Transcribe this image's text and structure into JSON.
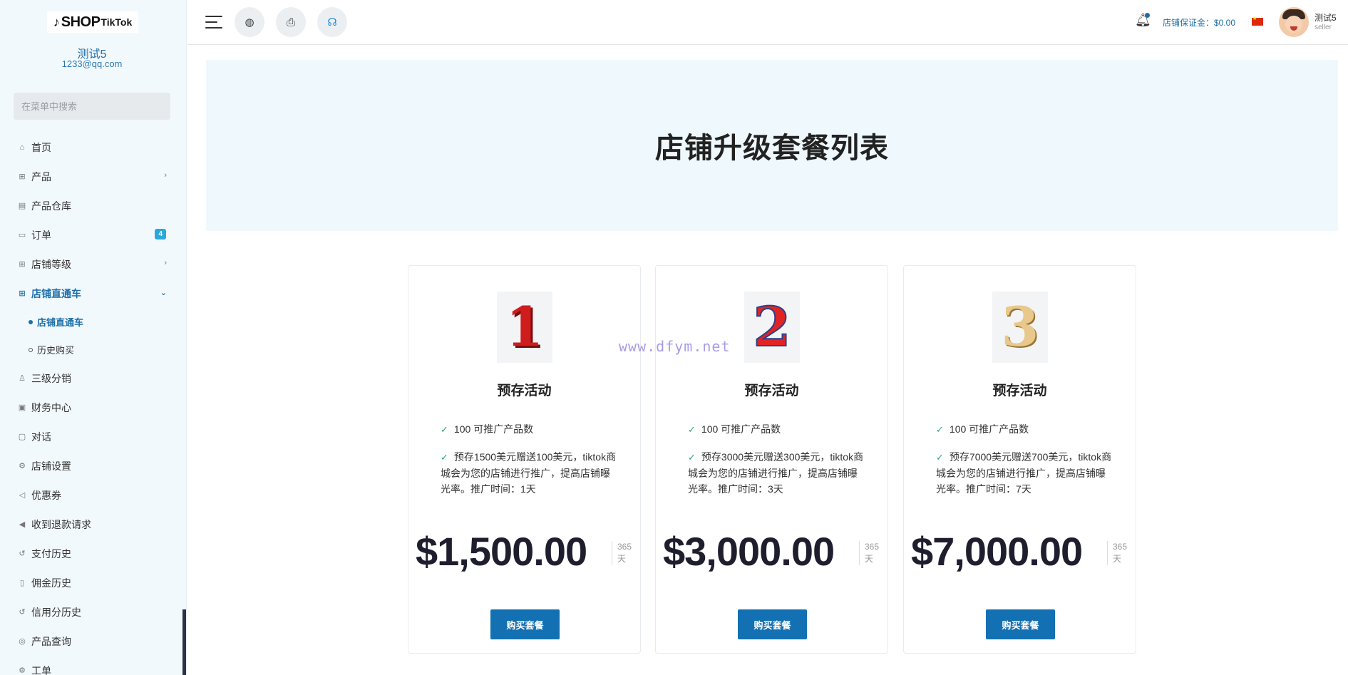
{
  "brand": {
    "logo_note": "♪",
    "logo_shop": "SHOP",
    "logo_tiktok": "TikTok"
  },
  "user": {
    "name": "测试5",
    "email": "1233@qq.com",
    "role": "seller"
  },
  "search": {
    "placeholder": "在菜单中搜索"
  },
  "menu": [
    {
      "label": "首页",
      "icon": "home-icon"
    },
    {
      "label": "产品",
      "icon": "cart-icon",
      "expandable": true
    },
    {
      "label": "产品仓库",
      "icon": "warehouse-icon"
    },
    {
      "label": "订单",
      "icon": "order-icon",
      "badge": "4"
    },
    {
      "label": "店铺等级",
      "icon": "cart-icon",
      "expandable": true
    },
    {
      "label": "店铺直通车",
      "icon": "cart-icon",
      "expanded": true,
      "active": true
    },
    {
      "label": "三级分销",
      "icon": "user-icon"
    },
    {
      "label": "财务中心",
      "icon": "wallet-icon"
    },
    {
      "label": "对话",
      "icon": "chat-icon"
    },
    {
      "label": "店铺设置",
      "icon": "gear-icon"
    },
    {
      "label": "优惠券",
      "icon": "megaphone-icon"
    },
    {
      "label": "收到退款请求",
      "icon": "refund-icon"
    },
    {
      "label": "支付历史",
      "icon": "history-icon"
    },
    {
      "label": "佣金历史",
      "icon": "document-icon"
    },
    {
      "label": "信用分历史",
      "icon": "history-icon"
    },
    {
      "label": "产品查询",
      "icon": "search-circle-icon"
    },
    {
      "label": "工单",
      "icon": "gear-icon"
    }
  ],
  "submenu": [
    {
      "label": "店铺直通车",
      "active": true
    },
    {
      "label": "历史购买",
      "active": false
    }
  ],
  "header": {
    "deposit": "店铺保证金：$0.00"
  },
  "page": {
    "title": "店铺升级套餐列表"
  },
  "plans": [
    {
      "badge_number": "1",
      "title": "预存活动",
      "feature_1": "100 可推广产品数",
      "feature_2": "预存1500美元赠送100美元，tiktok商城会为您的店铺进行推广，提高店铺曝光率。推广时间：1天",
      "price": "$1,500.00",
      "period_num": "365",
      "period_unit": "天",
      "button": "购买套餐"
    },
    {
      "badge_number": "2",
      "title": "预存活动",
      "feature_1": "100 可推广产品数",
      "feature_2": "预存3000美元赠送300美元，tiktok商城会为您的店铺进行推广，提高店铺曝光率。推广时间：3天",
      "price": "$3,000.00",
      "period_num": "365",
      "period_unit": "天",
      "button": "购买套餐"
    },
    {
      "badge_number": "3",
      "title": "预存活动",
      "feature_1": "100 可推广产品数",
      "feature_2": "预存7000美元赠送700美元，tiktok商城会为您的店铺进行推广，提高店铺曝光率。推广时间：7天",
      "price": "$7,000.00",
      "period_num": "365",
      "period_unit": "天",
      "button": "购买套餐"
    }
  ],
  "watermark": "www.dfym.net",
  "colors": {
    "accent": "#1b6fa8",
    "button": "#1371b3",
    "badge": "#29a8df",
    "banner_bg": "#eff8fd",
    "sidebar_bg": "#f2f9fd"
  }
}
